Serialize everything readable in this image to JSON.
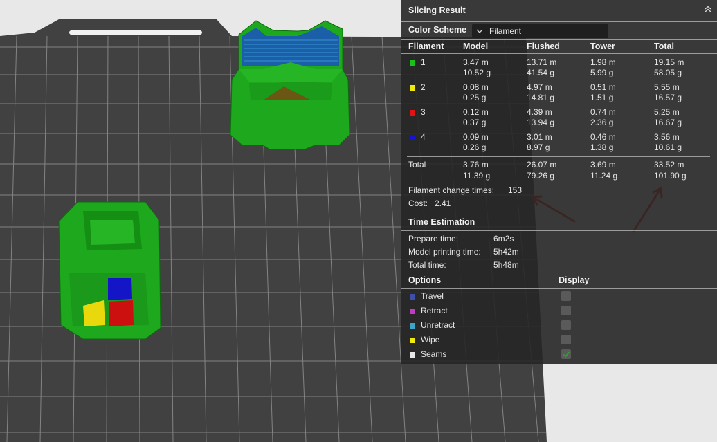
{
  "panel": {
    "title": "Slicing Result",
    "color_scheme_label": "Color Scheme",
    "color_scheme_value": "Filament"
  },
  "filament_table": {
    "headers": [
      "Filament",
      "Model",
      "Flushed",
      "Tower",
      "Total"
    ],
    "rows": [
      {
        "id": "1",
        "color": "#19c119",
        "model_len": "3.47 m",
        "model_wt": "10.52 g",
        "flushed_len": "13.71 m",
        "flushed_wt": "41.54 g",
        "tower_len": "1.98 m",
        "tower_wt": "5.99 g",
        "total_len": "19.15 m",
        "total_wt": "58.05 g"
      },
      {
        "id": "2",
        "color": "#f0ea0c",
        "model_len": "0.08 m",
        "model_wt": "0.25 g",
        "flushed_len": "4.97 m",
        "flushed_wt": "14.81 g",
        "tower_len": "0.51 m",
        "tower_wt": "1.51 g",
        "total_len": "5.55 m",
        "total_wt": "16.57 g"
      },
      {
        "id": "3",
        "color": "#e01212",
        "model_len": "0.12 m",
        "model_wt": "0.37 g",
        "flushed_len": "4.39 m",
        "flushed_wt": "13.94 g",
        "tower_len": "0.74 m",
        "tower_wt": "2.36 g",
        "total_len": "5.25 m",
        "total_wt": "16.67 g"
      },
      {
        "id": "4",
        "color": "#1414d6",
        "model_len": "0.09 m",
        "model_wt": "0.26 g",
        "flushed_len": "3.01 m",
        "flushed_wt": "8.97 g",
        "tower_len": "0.46 m",
        "tower_wt": "1.38 g",
        "total_len": "3.56 m",
        "total_wt": "10.61 g"
      }
    ],
    "total": {
      "label": "Total",
      "model_len": "3.76 m",
      "model_wt": "11.39 g",
      "flushed_len": "26.07 m",
      "flushed_wt": "79.26 g",
      "tower_len": "3.69 m",
      "tower_wt": "11.24 g",
      "total_len": "33.52 m",
      "total_wt": "101.90 g"
    },
    "change_times_label": "Filament change times:",
    "change_times_value": "153",
    "cost_label": "Cost:",
    "cost_value": "2.41"
  },
  "time_estimation": {
    "title": "Time Estimation",
    "prepare_label": "Prepare time:",
    "prepare_value": "6m2s",
    "model_label": "Model printing time:",
    "model_value": "5h42m",
    "total_label": "Total time:",
    "total_value": "5h48m"
  },
  "options": {
    "title": "Options",
    "display_title": "Display",
    "items": [
      {
        "label": "Travel",
        "color": "#3d4fa8",
        "checked": false
      },
      {
        "label": "Retract",
        "color": "#c23ac2",
        "checked": false
      },
      {
        "label": "Unretract",
        "color": "#3aa7c8",
        "checked": false
      },
      {
        "label": "Wipe",
        "color": "#f0ea0c",
        "checked": false
      },
      {
        "label": "Seams",
        "color": "#e6e6e6",
        "checked": true
      }
    ]
  },
  "colors": {
    "plate": "#414141",
    "grid": "#9a9a9a",
    "model_green": "#1ea81e",
    "annotation_arrow": "#ff1a1a",
    "checkmark": "#2aa52a"
  }
}
